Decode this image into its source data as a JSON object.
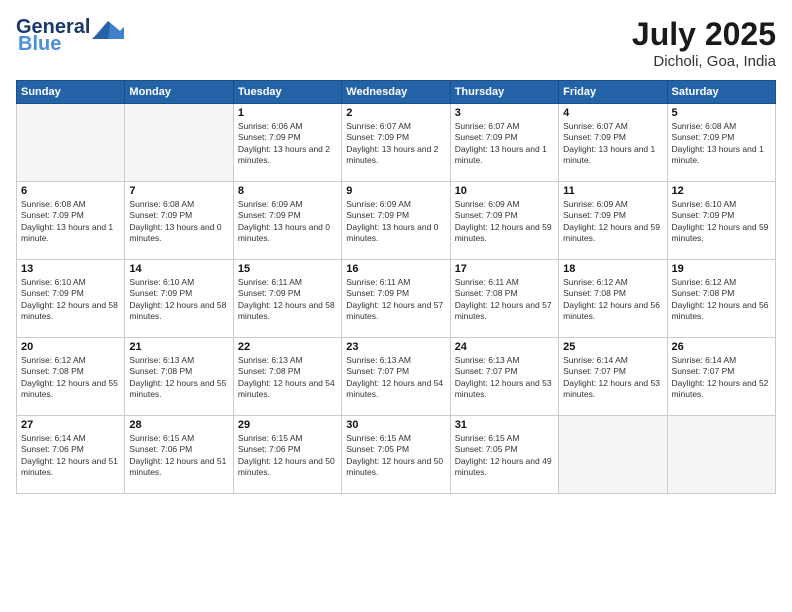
{
  "header": {
    "logo_general": "General",
    "logo_blue": "Blue",
    "month_title": "July 2025",
    "location": "Dicholi, Goa, India"
  },
  "days_of_week": [
    "Sunday",
    "Monday",
    "Tuesday",
    "Wednesday",
    "Thursday",
    "Friday",
    "Saturday"
  ],
  "weeks": [
    [
      {
        "day": "",
        "info": ""
      },
      {
        "day": "",
        "info": ""
      },
      {
        "day": "1",
        "info": "Sunrise: 6:06 AM\nSunset: 7:09 PM\nDaylight: 13 hours and 2 minutes."
      },
      {
        "day": "2",
        "info": "Sunrise: 6:07 AM\nSunset: 7:09 PM\nDaylight: 13 hours and 2 minutes."
      },
      {
        "day": "3",
        "info": "Sunrise: 6:07 AM\nSunset: 7:09 PM\nDaylight: 13 hours and 1 minute."
      },
      {
        "day": "4",
        "info": "Sunrise: 6:07 AM\nSunset: 7:09 PM\nDaylight: 13 hours and 1 minute."
      },
      {
        "day": "5",
        "info": "Sunrise: 6:08 AM\nSunset: 7:09 PM\nDaylight: 13 hours and 1 minute."
      }
    ],
    [
      {
        "day": "6",
        "info": "Sunrise: 6:08 AM\nSunset: 7:09 PM\nDaylight: 13 hours and 1 minute."
      },
      {
        "day": "7",
        "info": "Sunrise: 6:08 AM\nSunset: 7:09 PM\nDaylight: 13 hours and 0 minutes."
      },
      {
        "day": "8",
        "info": "Sunrise: 6:09 AM\nSunset: 7:09 PM\nDaylight: 13 hours and 0 minutes."
      },
      {
        "day": "9",
        "info": "Sunrise: 6:09 AM\nSunset: 7:09 PM\nDaylight: 13 hours and 0 minutes."
      },
      {
        "day": "10",
        "info": "Sunrise: 6:09 AM\nSunset: 7:09 PM\nDaylight: 12 hours and 59 minutes."
      },
      {
        "day": "11",
        "info": "Sunrise: 6:09 AM\nSunset: 7:09 PM\nDaylight: 12 hours and 59 minutes."
      },
      {
        "day": "12",
        "info": "Sunrise: 6:10 AM\nSunset: 7:09 PM\nDaylight: 12 hours and 59 minutes."
      }
    ],
    [
      {
        "day": "13",
        "info": "Sunrise: 6:10 AM\nSunset: 7:09 PM\nDaylight: 12 hours and 58 minutes."
      },
      {
        "day": "14",
        "info": "Sunrise: 6:10 AM\nSunset: 7:09 PM\nDaylight: 12 hours and 58 minutes."
      },
      {
        "day": "15",
        "info": "Sunrise: 6:11 AM\nSunset: 7:09 PM\nDaylight: 12 hours and 58 minutes."
      },
      {
        "day": "16",
        "info": "Sunrise: 6:11 AM\nSunset: 7:09 PM\nDaylight: 12 hours and 57 minutes."
      },
      {
        "day": "17",
        "info": "Sunrise: 6:11 AM\nSunset: 7:08 PM\nDaylight: 12 hours and 57 minutes."
      },
      {
        "day": "18",
        "info": "Sunrise: 6:12 AM\nSunset: 7:08 PM\nDaylight: 12 hours and 56 minutes."
      },
      {
        "day": "19",
        "info": "Sunrise: 6:12 AM\nSunset: 7:08 PM\nDaylight: 12 hours and 56 minutes."
      }
    ],
    [
      {
        "day": "20",
        "info": "Sunrise: 6:12 AM\nSunset: 7:08 PM\nDaylight: 12 hours and 55 minutes."
      },
      {
        "day": "21",
        "info": "Sunrise: 6:13 AM\nSunset: 7:08 PM\nDaylight: 12 hours and 55 minutes."
      },
      {
        "day": "22",
        "info": "Sunrise: 6:13 AM\nSunset: 7:08 PM\nDaylight: 12 hours and 54 minutes."
      },
      {
        "day": "23",
        "info": "Sunrise: 6:13 AM\nSunset: 7:07 PM\nDaylight: 12 hours and 54 minutes."
      },
      {
        "day": "24",
        "info": "Sunrise: 6:13 AM\nSunset: 7:07 PM\nDaylight: 12 hours and 53 minutes."
      },
      {
        "day": "25",
        "info": "Sunrise: 6:14 AM\nSunset: 7:07 PM\nDaylight: 12 hours and 53 minutes."
      },
      {
        "day": "26",
        "info": "Sunrise: 6:14 AM\nSunset: 7:07 PM\nDaylight: 12 hours and 52 minutes."
      }
    ],
    [
      {
        "day": "27",
        "info": "Sunrise: 6:14 AM\nSunset: 7:06 PM\nDaylight: 12 hours and 51 minutes."
      },
      {
        "day": "28",
        "info": "Sunrise: 6:15 AM\nSunset: 7:06 PM\nDaylight: 12 hours and 51 minutes."
      },
      {
        "day": "29",
        "info": "Sunrise: 6:15 AM\nSunset: 7:06 PM\nDaylight: 12 hours and 50 minutes."
      },
      {
        "day": "30",
        "info": "Sunrise: 6:15 AM\nSunset: 7:05 PM\nDaylight: 12 hours and 50 minutes."
      },
      {
        "day": "31",
        "info": "Sunrise: 6:15 AM\nSunset: 7:05 PM\nDaylight: 12 hours and 49 minutes."
      },
      {
        "day": "",
        "info": ""
      },
      {
        "day": "",
        "info": ""
      }
    ]
  ]
}
